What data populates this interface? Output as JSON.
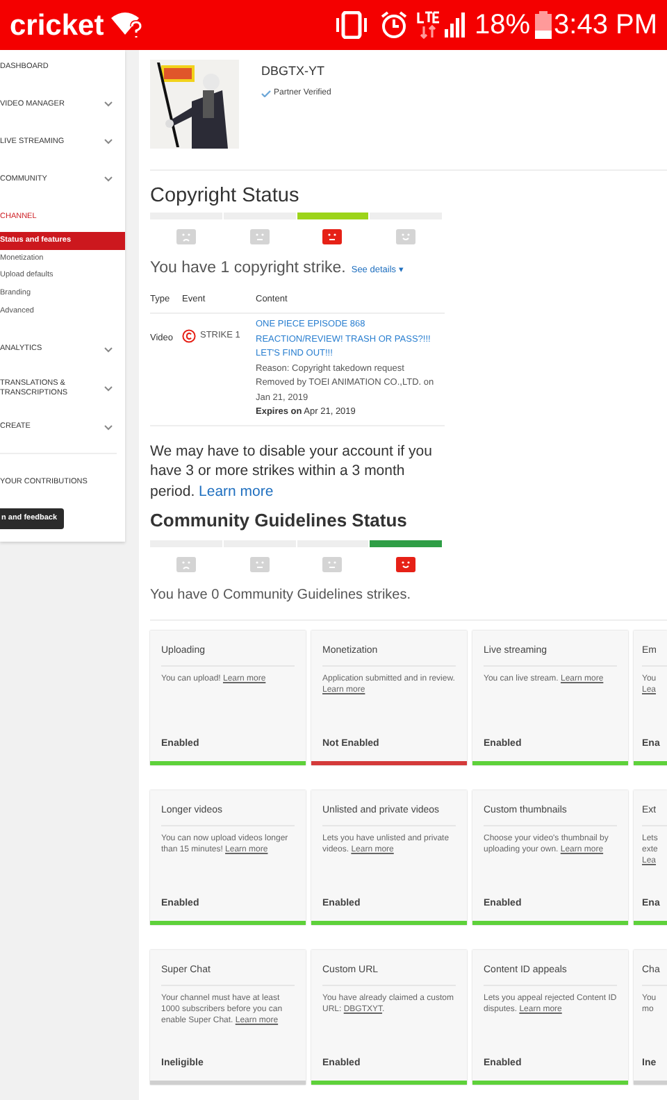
{
  "status_bar": {
    "carrier": "cricket",
    "battery": "18%",
    "time": "3:43 PM"
  },
  "sidebar": {
    "items": [
      {
        "label": "DASHBOARD",
        "selected": false,
        "expandable": false
      },
      {
        "label": "VIDEO MANAGER",
        "selected": false,
        "expandable": true
      },
      {
        "label": "LIVE STREAMING",
        "selected": false,
        "expandable": true
      },
      {
        "label": "COMMUNITY",
        "selected": false,
        "expandable": true
      },
      {
        "label": "CHANNEL",
        "selected": true,
        "expandable": false,
        "children": [
          {
            "label": "Status and features",
            "selected": true
          },
          {
            "label": "Monetization",
            "selected": false
          },
          {
            "label": "Upload defaults",
            "selected": false
          },
          {
            "label": "Branding",
            "selected": false
          },
          {
            "label": "Advanced",
            "selected": false
          }
        ]
      },
      {
        "label": "ANALYTICS",
        "selected": false,
        "expandable": true
      },
      {
        "label": "TRANSLATIONS & TRANSCRIPTIONS",
        "selected": false,
        "expandable": true
      },
      {
        "label": "CREATE",
        "selected": false,
        "expandable": true
      }
    ],
    "contributions": "YOUR CONTRIBUTIONS",
    "feedback_button": "n and feedback"
  },
  "channel": {
    "name": "DBGTX-YT",
    "badge": "Partner Verified"
  },
  "copyright_status": {
    "title": "Copyright Status",
    "meter": [
      {
        "kind": "sad",
        "selected": false
      },
      {
        "kind": "neutral",
        "selected": false
      },
      {
        "kind": "neutral",
        "selected": true
      },
      {
        "kind": "smile",
        "selected": false
      }
    ],
    "summary": "You have 1 copyright strike.",
    "details_link": "See details ▾",
    "table": {
      "columns": [
        "Type",
        "Event",
        "Content"
      ],
      "rows": [
        {
          "type": "Video",
          "event": "STRIKE 1",
          "title": "ONE PIECE EPISODE 868 REACTION/REVIEW! TRASH OR PASS?!!! LET'S FIND OUT!!!",
          "reason": "Reason: Copyright takedown request",
          "removed": "Removed by TOEI ANIMATION CO.,LTD. on Jan 21, 2019",
          "expires": "**Expires on** Apr 21, 2019"
        }
      ]
    },
    "warning": "We may have to disable your account if you have 3 or more strikes within a 3 month period.",
    "warning_link": "Learn more"
  },
  "community_guidelines": {
    "title": "Community Guidelines Status",
    "meter": [
      {
        "kind": "sad",
        "selected": false
      },
      {
        "kind": "neutral",
        "selected": false
      },
      {
        "kind": "neutral",
        "selected": false
      },
      {
        "kind": "smile",
        "selected": true
      }
    ],
    "summary": "You have 0 Community Guidelines strikes."
  },
  "features": [
    {
      "title": "Uploading",
      "text": "You can upload!",
      "link": "Learn more",
      "status": "Enabled",
      "kind": "enabled"
    },
    {
      "title": "Monetization",
      "text": "Application submitted and in review.",
      "link": "Learn more",
      "status": "Not Enabled",
      "kind": "not_enabled"
    },
    {
      "title": "Live streaming",
      "text": "You can live stream.",
      "link": "Learn more",
      "status": "Enabled",
      "kind": "enabled"
    },
    {
      "title": "Em",
      "text": "You",
      "link": "Lea",
      "status": "Ena",
      "kind": "enabled"
    },
    {
      "title": "Longer videos",
      "text": "You can now upload videos longer than 15 minutes!",
      "link": "Learn more",
      "status": "Enabled",
      "kind": "enabled"
    },
    {
      "title": "Unlisted and private videos",
      "text": "Lets you have unlisted and private videos.",
      "link": "Learn more",
      "status": "Enabled",
      "kind": "enabled"
    },
    {
      "title": "Custom thumbnails",
      "text": "Choose your video's thumbnail by uploading your own.",
      "link": "Learn more",
      "status": "Enabled",
      "kind": "enabled"
    },
    {
      "title": "Ext",
      "text": "Lets exte",
      "link": "Lea",
      "status": "Ena",
      "kind": "enabled"
    },
    {
      "title": "Super Chat",
      "text": "Your channel must have at least 1000 subscribers before you can enable Super Chat.",
      "link": "Learn more",
      "status": "Ineligible",
      "kind": "ineligible"
    },
    {
      "title": "Custom URL",
      "text": "You have already claimed a custom URL:",
      "link": "DBGTXYT",
      "after": ".",
      "status": "Enabled",
      "kind": "enabled"
    },
    {
      "title": "Content ID appeals",
      "text": "Lets you appeal rejected Content ID disputes.",
      "link": "Learn more",
      "status": "Enabled",
      "kind": "enabled"
    },
    {
      "title": "Cha",
      "text": "You mo",
      "status": "Ine",
      "kind": "ineligible"
    }
  ]
}
